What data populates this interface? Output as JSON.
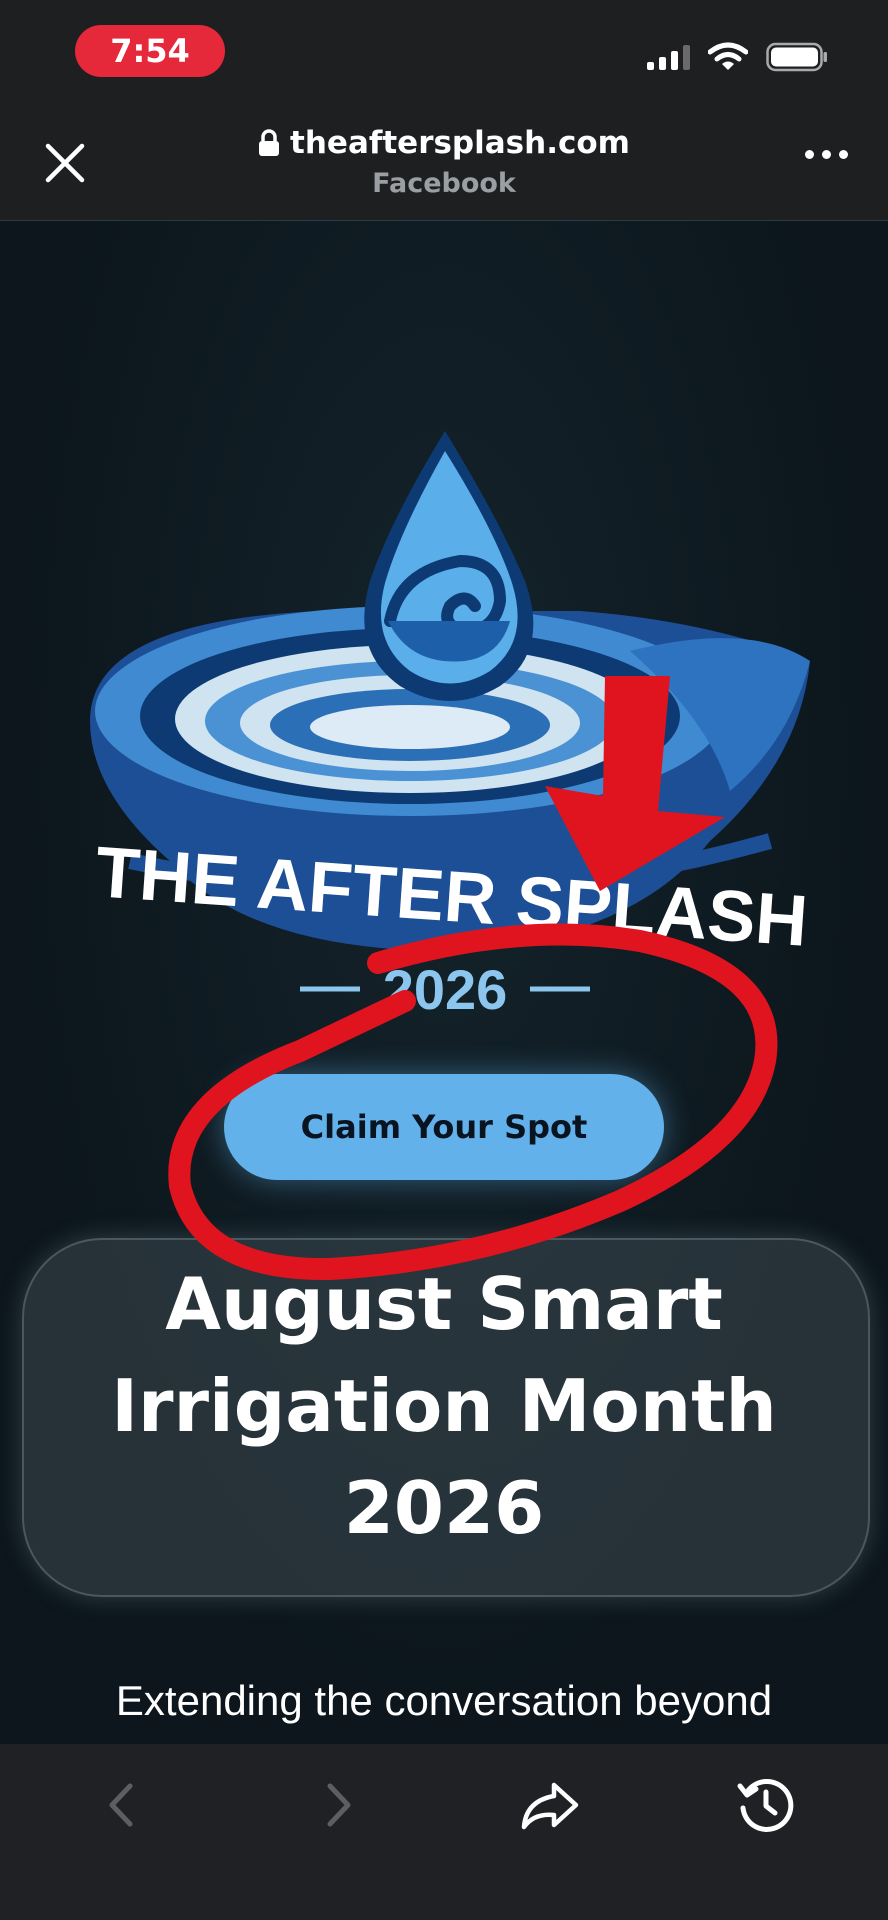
{
  "status": {
    "time": "7:54",
    "pill_color": "#e5283a"
  },
  "browser": {
    "url": "theaftersplash.com",
    "source": "Facebook"
  },
  "logo": {
    "brand_text": "THE AFTER SPLASH",
    "year_text": "2026"
  },
  "cta": {
    "label": "Claim Your Spot"
  },
  "headline": {
    "line1": "August Smart",
    "line2": "Irrigation Month",
    "line3": "2026"
  },
  "subtext": "Extending the conversation beyond",
  "toolbar": {
    "icons": [
      "back-icon",
      "forward-icon",
      "share-icon",
      "history-icon"
    ]
  },
  "colors": {
    "accent": "#62b1ea",
    "annotation_red": "#e0141e"
  }
}
